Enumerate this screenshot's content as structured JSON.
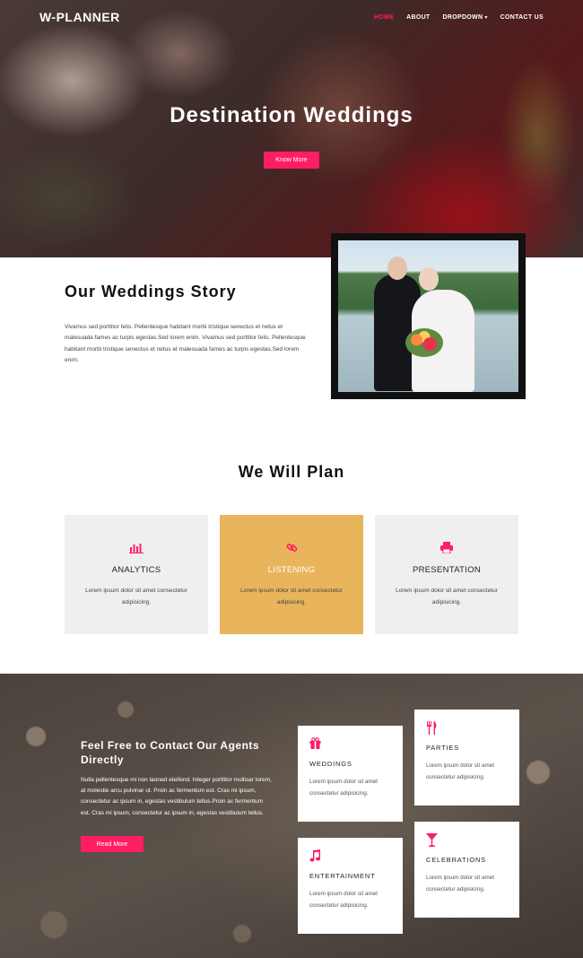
{
  "brand": {
    "logo": "W-PLANNER"
  },
  "nav": {
    "items": [
      {
        "label": "HOME",
        "active": true
      },
      {
        "label": "ABOUT",
        "active": false
      },
      {
        "label": "DROPDOWN",
        "active": false,
        "has_caret": true
      },
      {
        "label": "CONTACT US",
        "active": false
      }
    ]
  },
  "hero": {
    "title": "Destination Weddings",
    "button": "Know More"
  },
  "story": {
    "title": "Our Weddings Story",
    "text": "Vivamus sed porttitor felis. Pellentesque habitant morbi tristique senectus et netus et malesuada fames ac turpis egestas.Sed lorem enim. Vivamus sed porttitor felis. Pellentesque habitant morbi tristique senectus et netus et malesuada fames ac turpis egestas.Sed lorem enim."
  },
  "plan": {
    "title": "We Will Plan",
    "cards": [
      {
        "icon": "bar-chart-icon",
        "title": "ANALYTICS",
        "text": "Lorem ipsum dolor sit amet consectetur adipisicing."
      },
      {
        "icon": "link-icon",
        "title": "LISTENING",
        "text": "Lorem ipsum dolor sit amet consectetur adipisicing."
      },
      {
        "icon": "printer-icon",
        "title": "PRESENTATION",
        "text": "Lorem ipsum dolor sit amet consectetur adipisicing."
      }
    ]
  },
  "contact": {
    "title": "Feel Free to Contact Our Agents Directly",
    "text": "Nulla pellentesque mi non laoreet eleifend. Integer porttitor mollisar lorem, at molestie arcu pulvinar ut. Proin ac fermentum est. Cras mi ipsum, consectetur ac ipsum in, egestas vestibulum tellus.Proin ac fermentum est. Cras mi ipsum, consectetur ac ipsum in, egestas vestibulum tellus.",
    "button": "Read More"
  },
  "services": [
    {
      "icon": "gift-icon",
      "title": "WEDDINGS",
      "text": "Lorem ipsum dolor sit amet consectetur adipisicing."
    },
    {
      "icon": "cutlery-icon",
      "title": "PARTIES",
      "text": "Lorem ipsum dolor sit amet consectetur adipisicing."
    },
    {
      "icon": "music-icon",
      "title": "ENTERTAINMENT",
      "text": "Lorem ipsum dolor sit amet consectetur adipisicing."
    },
    {
      "icon": "cocktail-icon",
      "title": "CELEBRATIONS",
      "text": "Lorem ipsum dolor sit amet consectetur adipisicing."
    }
  ],
  "colors": {
    "accent": "#ff1d63",
    "highlight_card": "#e8b55c",
    "card_bg": "#efefef",
    "contact_bg": "#4a423c"
  }
}
